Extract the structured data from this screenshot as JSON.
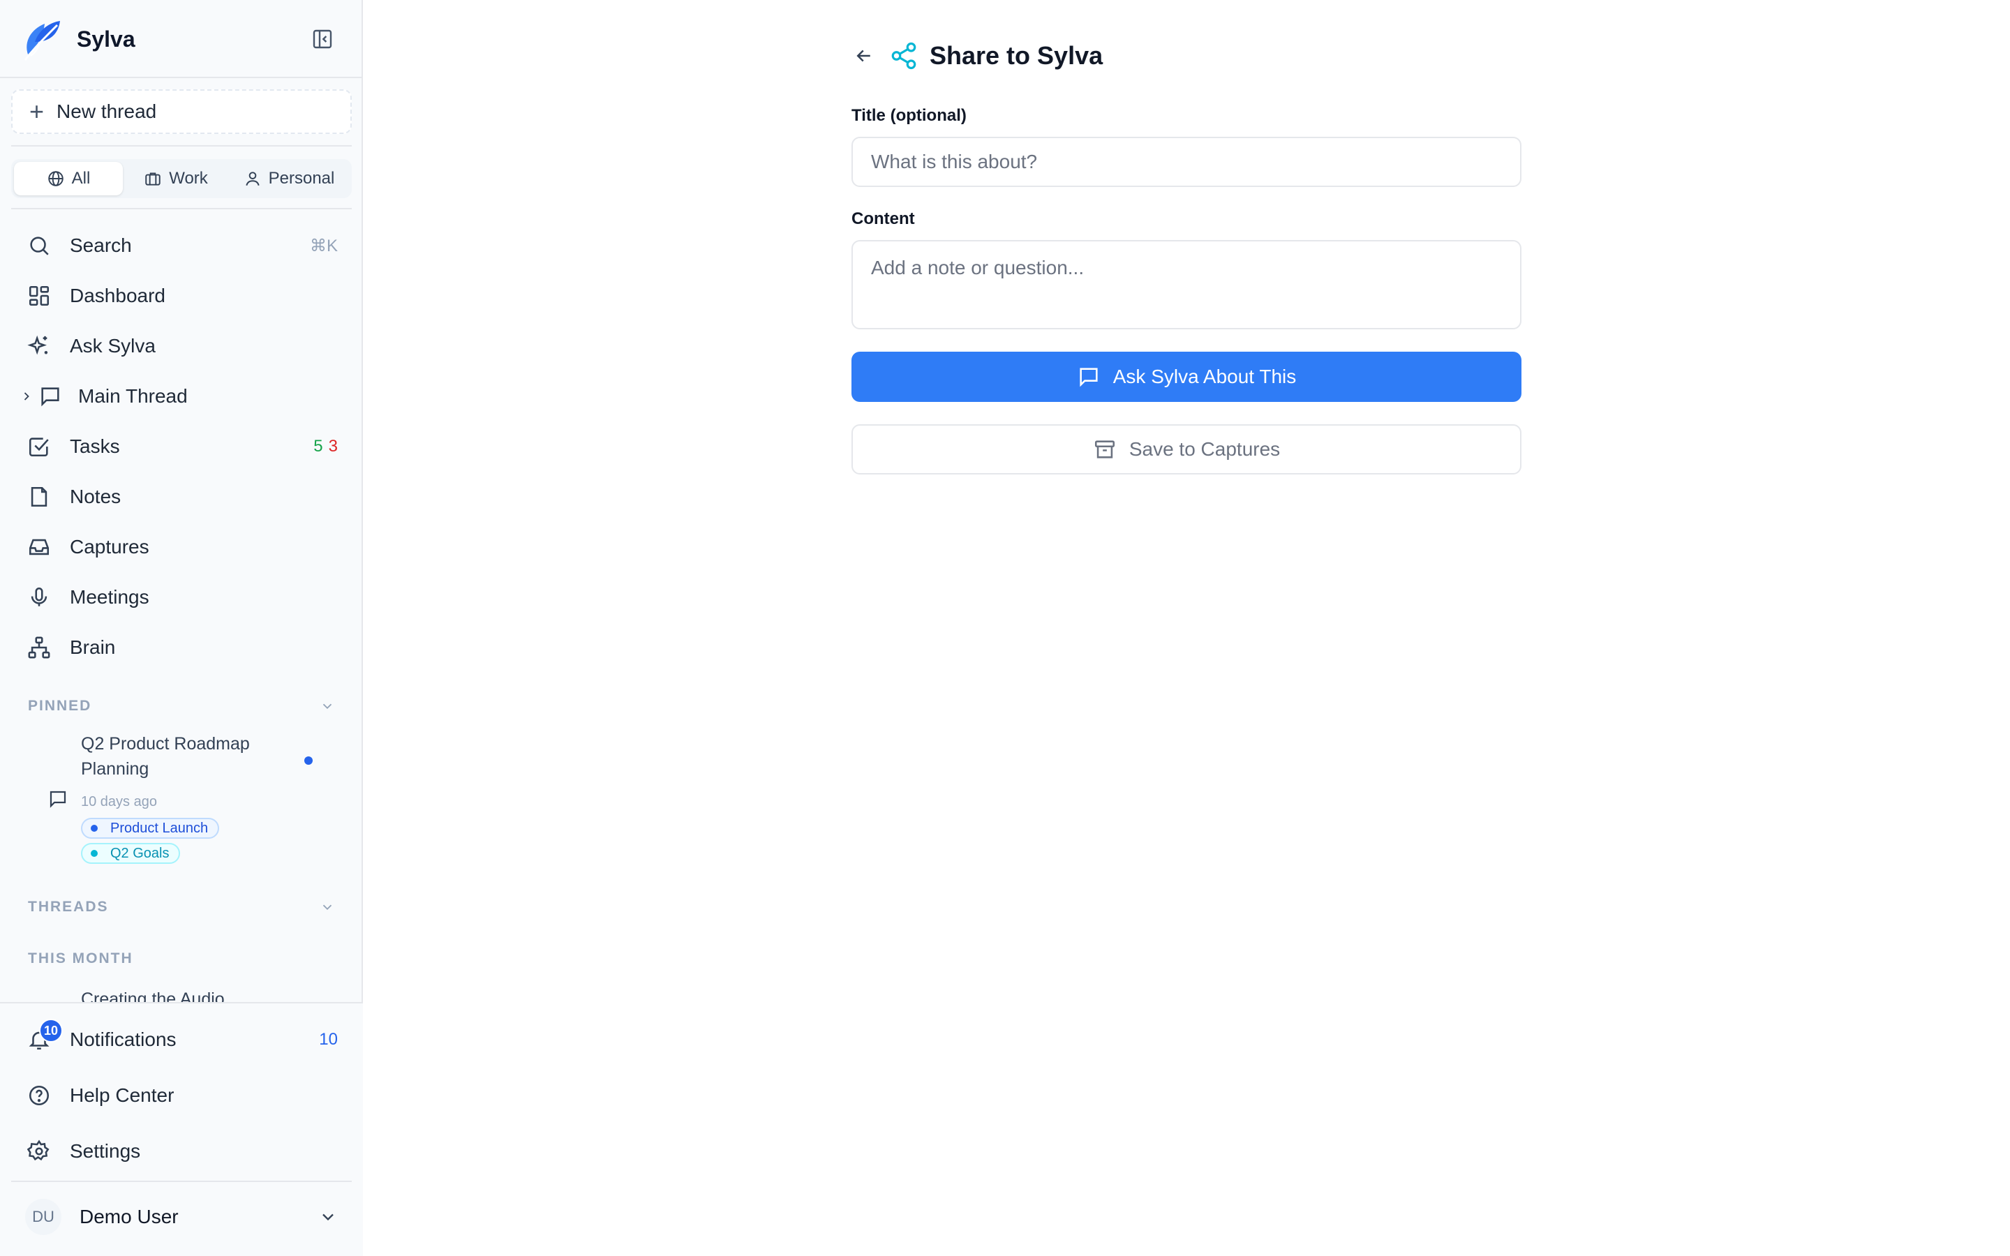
{
  "app": {
    "name": "Sylva"
  },
  "sidebar": {
    "new_thread_label": "New thread",
    "filters": [
      {
        "label": "All",
        "icon": "globe-icon",
        "active": true
      },
      {
        "label": "Work",
        "icon": "briefcase-icon",
        "active": false
      },
      {
        "label": "Personal",
        "icon": "user-icon",
        "active": false
      }
    ],
    "nav": [
      {
        "label": "Search",
        "icon": "search-icon",
        "shortcut": "⌘K"
      },
      {
        "label": "Dashboard",
        "icon": "dashboard-icon"
      },
      {
        "label": "Ask Sylva",
        "icon": "sparkles-icon"
      },
      {
        "label": "Main Thread",
        "icon": "chat-icon",
        "expandable": true
      },
      {
        "label": "Tasks",
        "icon": "checkbox-icon",
        "count_green": "5",
        "count_red": "3"
      },
      {
        "label": "Notes",
        "icon": "file-icon"
      },
      {
        "label": "Captures",
        "icon": "inbox-icon"
      },
      {
        "label": "Meetings",
        "icon": "microphone-icon"
      },
      {
        "label": "Brain",
        "icon": "network-icon"
      }
    ],
    "pinned_header": "PINNED",
    "pinned": {
      "title": "Q2 Product Roadmap Planning",
      "time": "10 days ago",
      "tags": [
        {
          "label": "Product Launch",
          "color": "#2563eb"
        },
        {
          "label": "Q2 Goals",
          "color": "#0891b2"
        }
      ]
    },
    "threads_header": "THREADS",
    "this_month_header": "THIS MONTH",
    "partial_thread": "Creating the Audio",
    "bottom": {
      "notifications_label": "Notifications",
      "notifications_count": "10",
      "notifications_badge": "10",
      "help_label": "Help Center",
      "settings_label": "Settings"
    },
    "user": {
      "initials": "DU",
      "name": "Demo User"
    }
  },
  "main": {
    "title": "Share to Sylva",
    "title_label": "Title (optional)",
    "title_placeholder": "What is this about?",
    "content_label": "Content",
    "content_placeholder": "Add a note or question...",
    "ask_button": "Ask Sylva About This",
    "save_button": "Save to Captures"
  },
  "colors": {
    "accent": "#2f7cf6",
    "share_icon": "#06b6d4",
    "tasks_green": "#16a34a",
    "tasks_red": "#dc2626"
  }
}
